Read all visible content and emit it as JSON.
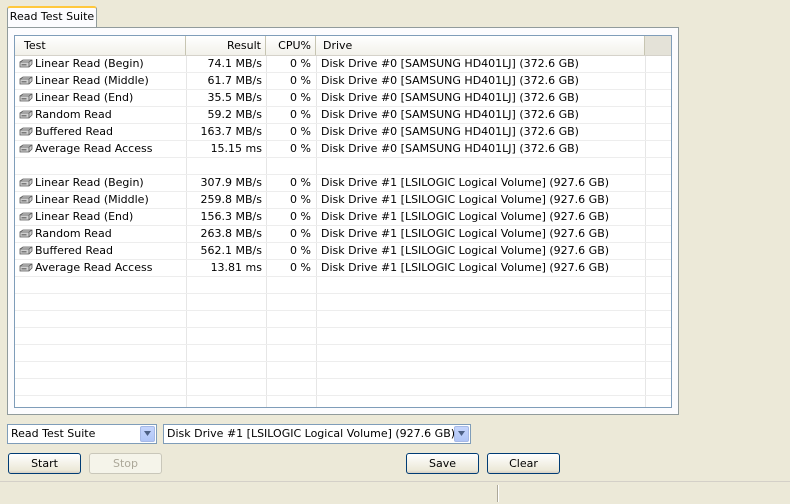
{
  "tab": {
    "label": "Read Test Suite"
  },
  "columns": [
    "Test",
    "Result",
    "CPU%",
    "Drive"
  ],
  "rows": [
    {
      "test": "Linear Read (Begin)",
      "result": "74.1 MB/s",
      "cpu": "0 %",
      "drive": "Disk Drive #0  [SAMSUNG HD401LJ]  (372.6 GB)"
    },
    {
      "test": "Linear Read (Middle)",
      "result": "61.7 MB/s",
      "cpu": "0 %",
      "drive": "Disk Drive #0  [SAMSUNG HD401LJ]  (372.6 GB)"
    },
    {
      "test": "Linear Read (End)",
      "result": "35.5 MB/s",
      "cpu": "0 %",
      "drive": "Disk Drive #0  [SAMSUNG HD401LJ]  (372.6 GB)"
    },
    {
      "test": "Random Read",
      "result": "59.2 MB/s",
      "cpu": "0 %",
      "drive": "Disk Drive #0  [SAMSUNG HD401LJ]  (372.6 GB)"
    },
    {
      "test": "Buffered Read",
      "result": "163.7 MB/s",
      "cpu": "0 %",
      "drive": "Disk Drive #0  [SAMSUNG HD401LJ]  (372.6 GB)"
    },
    {
      "test": "Average Read Access",
      "result": "15.15 ms",
      "cpu": "0 %",
      "drive": "Disk Drive #0  [SAMSUNG HD401LJ]  (372.6 GB)"
    },
    {
      "test": "",
      "result": "",
      "cpu": "",
      "drive": ""
    },
    {
      "test": "Linear Read (Begin)",
      "result": "307.9 MB/s",
      "cpu": "0 %",
      "drive": "Disk Drive #1  [LSILOGIC Logical Volume]  (927.6 GB)"
    },
    {
      "test": "Linear Read (Middle)",
      "result": "259.8 MB/s",
      "cpu": "0 %",
      "drive": "Disk Drive #1  [LSILOGIC Logical Volume]  (927.6 GB)"
    },
    {
      "test": "Linear Read (End)",
      "result": "156.3 MB/s",
      "cpu": "0 %",
      "drive": "Disk Drive #1  [LSILOGIC Logical Volume]  (927.6 GB)"
    },
    {
      "test": "Random Read",
      "result": "263.8 MB/s",
      "cpu": "0 %",
      "drive": "Disk Drive #1  [LSILOGIC Logical Volume]  (927.6 GB)"
    },
    {
      "test": "Buffered Read",
      "result": "562.1 MB/s",
      "cpu": "0 %",
      "drive": "Disk Drive #1  [LSILOGIC Logical Volume]  (927.6 GB)"
    },
    {
      "test": "Average Read Access",
      "result": "13.81 ms",
      "cpu": "0 %",
      "drive": "Disk Drive #1  [LSILOGIC Logical Volume]  (927.6 GB)"
    }
  ],
  "empty_rows": 8,
  "row_icon": "hard-drive-icon",
  "suite_select": {
    "value": "Read Test Suite"
  },
  "drive_select": {
    "value": "Disk Drive #1  [LSILOGIC Logical Volume]  (927.6 GB)"
  },
  "buttons": {
    "start": "Start",
    "stop": "Stop",
    "save": "Save",
    "clear": "Clear"
  },
  "colors": {
    "window_bg": "#ece9d8",
    "tab_accent": "#ffc83c",
    "list_border": "#7f9db9",
    "button_border": "#003c74"
  }
}
